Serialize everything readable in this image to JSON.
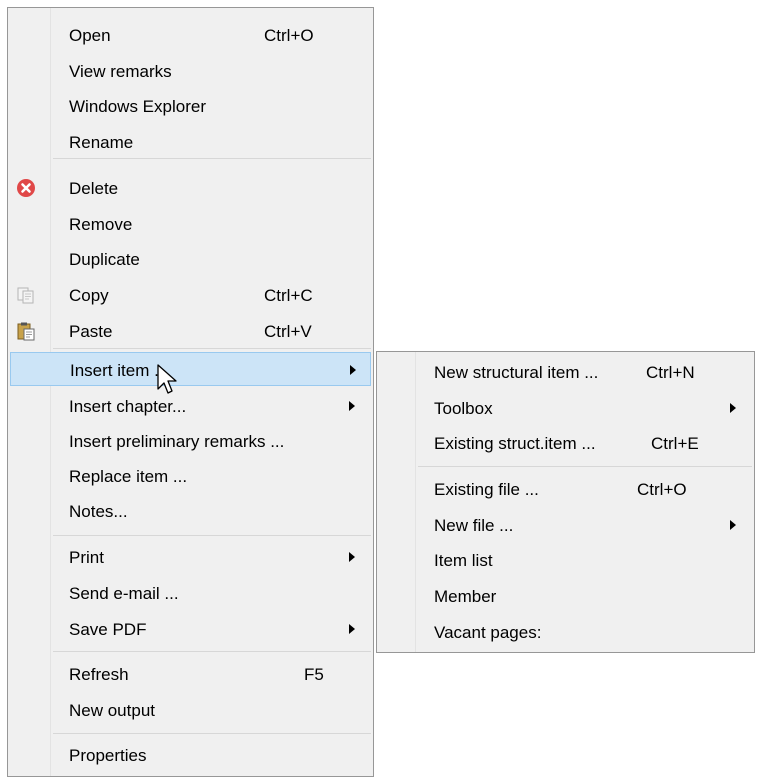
{
  "main_menu": {
    "items": [
      {
        "label": "Open",
        "shortcut": "Ctrl+O"
      },
      {
        "label": "View remarks"
      },
      {
        "label": "Windows Explorer"
      },
      {
        "label": "Rename"
      },
      {
        "label": "Delete",
        "icon": "delete-icon"
      },
      {
        "label": "Remove"
      },
      {
        "label": "Duplicate"
      },
      {
        "label": "Copy",
        "shortcut": "Ctrl+C",
        "icon": "copy-icon"
      },
      {
        "label": "Paste",
        "shortcut": "Ctrl+V",
        "icon": "paste-icon"
      },
      {
        "label": "Insert item ...",
        "submenu": true,
        "highlighted": true
      },
      {
        "label": "Insert chapter...",
        "submenu": true
      },
      {
        "label": "Insert preliminary remarks ..."
      },
      {
        "label": "Replace item ..."
      },
      {
        "label": "Notes..."
      },
      {
        "label": "Print",
        "submenu": true
      },
      {
        "label": "Send e-mail ..."
      },
      {
        "label": "Save PDF",
        "submenu": true
      },
      {
        "label": "Refresh",
        "shortcut": "F5"
      },
      {
        "label": "New output"
      },
      {
        "label": "Properties"
      }
    ]
  },
  "sub_menu": {
    "items": [
      {
        "label": "New structural item ...",
        "shortcut": "Ctrl+N"
      },
      {
        "label": "Toolbox",
        "submenu": true
      },
      {
        "label": "Existing struct.item ...",
        "shortcut": "Ctrl+E"
      },
      {
        "label": "Existing file ...",
        "shortcut": "Ctrl+O"
      },
      {
        "label": "New file ...",
        "submenu": true
      },
      {
        "label": "Item list"
      },
      {
        "label": "Member"
      },
      {
        "label": "Vacant pages:"
      }
    ]
  },
  "colors": {
    "menu_bg": "#f0f0f0",
    "highlight_bg": "#cce4f7",
    "highlight_border": "#99c9ef",
    "delete_red": "#e04848"
  }
}
